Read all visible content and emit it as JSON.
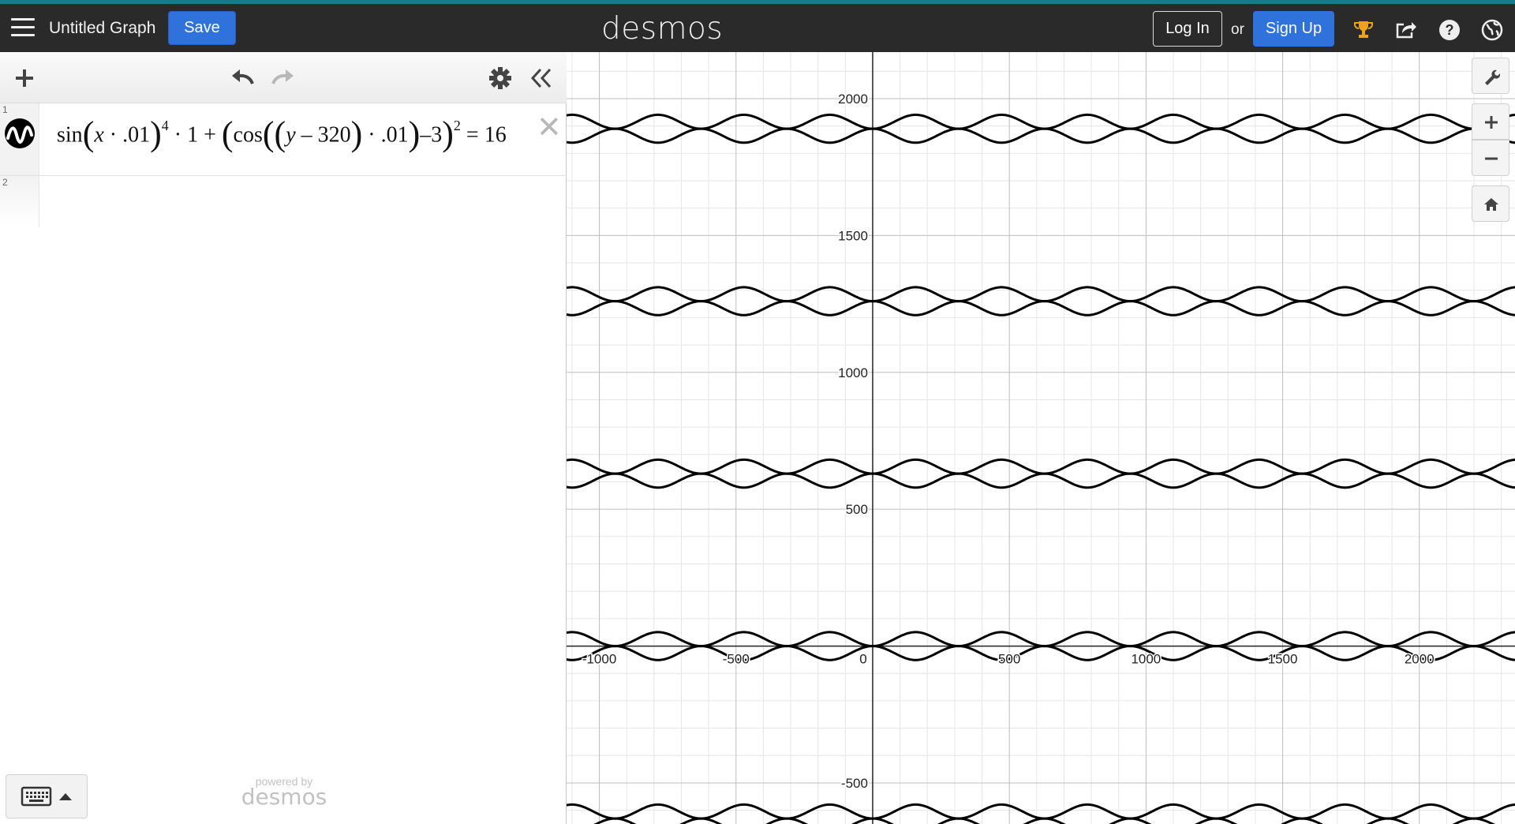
{
  "topbar": {
    "title": "Untitled Graph",
    "save_label": "Save",
    "brand": "desmos",
    "login_label": "Log In",
    "or_text": "or",
    "signup_label": "Sign Up",
    "accent_color": "#2f72dc",
    "icons": [
      "menu-icon",
      "trophy-icon",
      "share-icon",
      "help-icon",
      "globe-icon"
    ]
  },
  "expressions": [
    {
      "number": "1",
      "parts": {
        "sin": "sin",
        "x": "x",
        "dot1": " · .01",
        "exp4": "4",
        "times1": " · 1 + ",
        "cos": "cos",
        "y": "y",
        "minus320": " – 320",
        "dot2": " · .01",
        "minus3": "–3",
        "exp2": "2",
        "equals": " = 16"
      }
    },
    {
      "number": "2"
    }
  ],
  "footer": {
    "powered_by": "powered by",
    "brand": "desmos"
  },
  "graph": {
    "x_ticks": [
      "-1000",
      "-500",
      "0",
      "500",
      "1000",
      "1500",
      "2000"
    ],
    "y_ticks": [
      "2000",
      "1500",
      "1000",
      "500",
      "-500"
    ],
    "x_range": [
      -1120,
      2350
    ],
    "y_range": [
      -650,
      2170
    ],
    "major_step": 500,
    "minor_step": 100,
    "curve_color": "#000000",
    "band_centers": [
      1890,
      1260,
      630,
      0,
      -630
    ]
  }
}
